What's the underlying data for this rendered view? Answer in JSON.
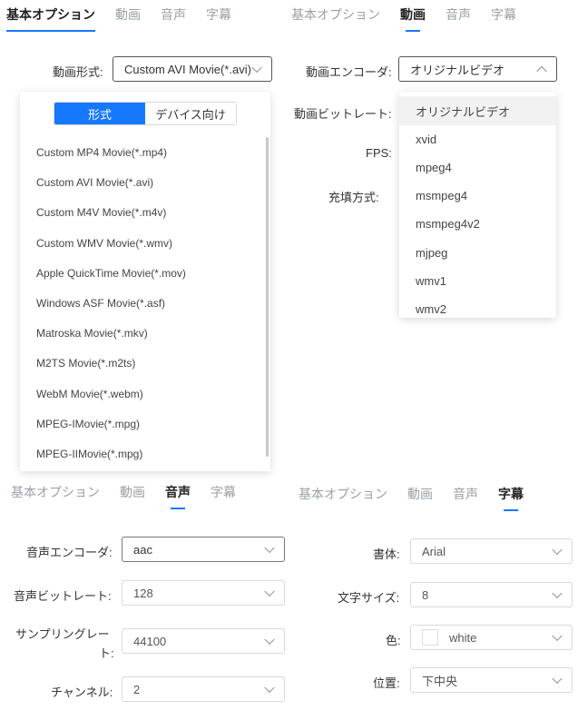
{
  "tabs": [
    "基本オプション",
    "動画",
    "音声",
    "字幕"
  ],
  "video": {
    "format_label": "動画形式:",
    "format_value": "Custom AVI Movie(*.avi)",
    "toggle_format": "形式",
    "toggle_device": "デバイス向け",
    "formats": [
      "Custom MP4 Movie(*.mp4)",
      "Custom AVI Movie(*.avi)",
      "Custom M4V Movie(*.m4v)",
      "Custom WMV Movie(*.wmv)",
      "Apple QuickTime Movie(*.mov)",
      "Windows ASF Movie(*.asf)",
      "Matroska Movie(*.mkv)",
      "M2TS Movie(*.m2ts)",
      "WebM Movie(*.webm)",
      "MPEG-IMovie(*.mpg)",
      "MPEG-IIMovie(*.mpg)"
    ],
    "encoder_label": "動画エンコーダ:",
    "encoder_value": "オリジナルビデオ",
    "bitrate_label": "動画ビットレート:",
    "fps_label": "FPS:",
    "fill_label": "充填方式:",
    "encoders": [
      "オリジナルビデオ",
      "xvid",
      "mpeg4",
      "msmpeg4",
      "msmpeg4v2",
      "mjpeg",
      "wmv1",
      "wmv2"
    ]
  },
  "audio": {
    "encoder_label": "音声エンコーダ:",
    "encoder_value": "aac",
    "bitrate_label": "音声ビットレート:",
    "bitrate_value": "128",
    "sampling_label_1": "サンプリングレー",
    "sampling_label_2": "ト:",
    "sampling_value": "44100",
    "channel_label": "チャンネル:",
    "channel_value": "2"
  },
  "subtitle": {
    "font_label": "書体:",
    "font_value": "Arial",
    "size_label": "文字サイズ:",
    "size_value": "8",
    "color_label": "色:",
    "color_value": "white",
    "position_label": "位置:",
    "position_value": "下中央"
  },
  "colors": {
    "accent": "#1677ff"
  }
}
